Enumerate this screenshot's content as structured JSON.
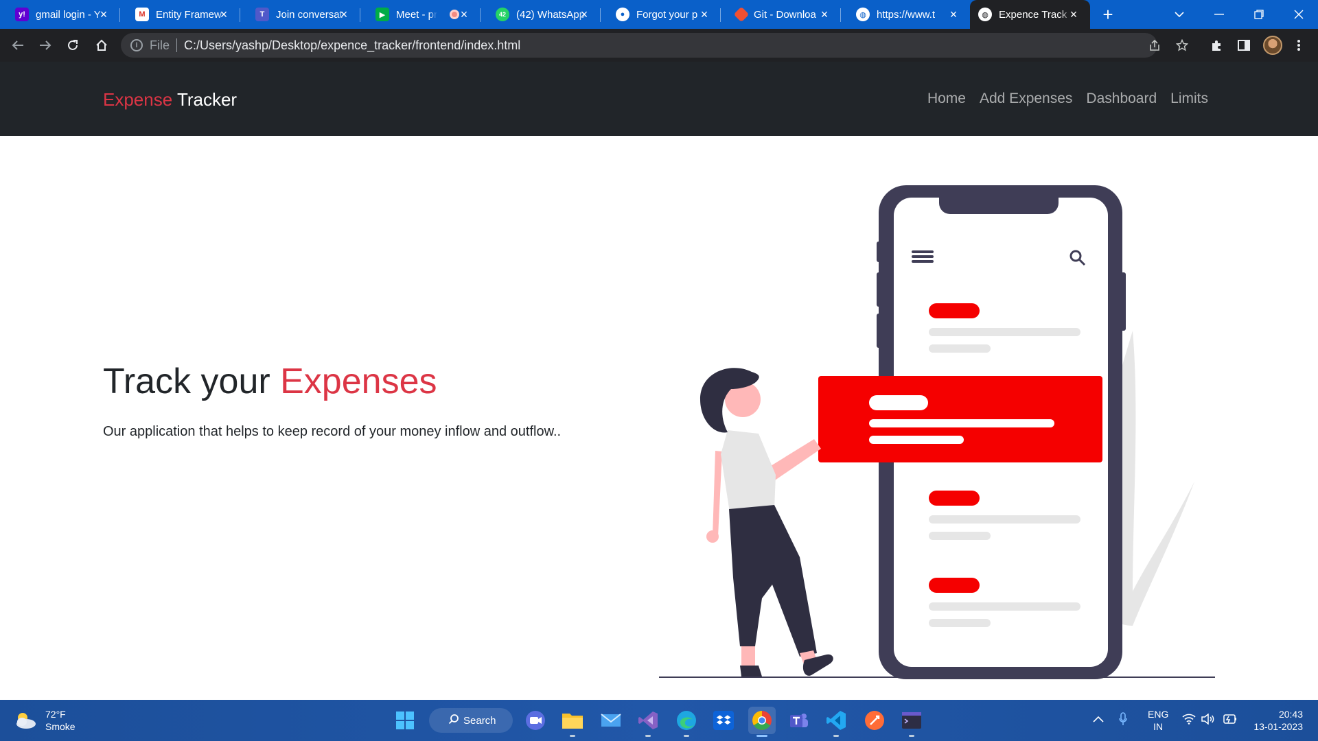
{
  "browser": {
    "tabs": [
      {
        "title": "gmail login - Y",
        "favicon": "yahoo-icon",
        "color": "#6001d2",
        "glyph": "y!"
      },
      {
        "title": "Entity Framew",
        "favicon": "gmail-icon",
        "color": "#ffffff",
        "glyph": "M"
      },
      {
        "title": "Join conversat",
        "favicon": "teams-icon",
        "color": "#5059c9",
        "glyph": "T"
      },
      {
        "title": "Meet - pr",
        "favicon": "meet-icon",
        "color": "#00ac47",
        "glyph": "▶"
      },
      {
        "title": "(42) WhatsApp",
        "favicon": "whatsapp-icon",
        "color": "#25d366",
        "glyph": "42"
      },
      {
        "title": "Forgot your p",
        "favicon": "github-icon",
        "color": "#ffffff",
        "glyph": "●"
      },
      {
        "title": "Git - Downloa",
        "favicon": "git-icon",
        "color": "#f05033",
        "glyph": "◆"
      },
      {
        "title": "https://www.t",
        "favicon": "globe-icon",
        "color": "#ffffff",
        "glyph": "◍"
      },
      {
        "title": "Expence Track",
        "favicon": "globe-icon",
        "color": "#ffffff",
        "glyph": "◍"
      }
    ],
    "address": {
      "scheme": "File",
      "url": "C:/Users/yashp/Desktop/expence_tracker/frontend/index.html"
    }
  },
  "site": {
    "brand": {
      "accent": "Expense",
      "rest": " Tracker"
    },
    "menu": [
      "Home",
      "Add Expenses",
      "Dashboard",
      "Limits"
    ],
    "hero": {
      "title_plain": "Track your ",
      "title_accent": "Expenses",
      "subtitle": "Our application that helps to keep record of your money inflow and outflow.."
    },
    "colors": {
      "accent": "#dc3545",
      "navbar": "#212529",
      "illustration_red": "#f50000",
      "phone": "#3f3d56"
    }
  },
  "taskbar": {
    "weather": {
      "temp": "72°F",
      "condition": "Smoke"
    },
    "search_label": "Search",
    "apps": [
      "start-icon",
      "search-icon",
      "zoom-icon",
      "file-explorer-icon",
      "mail-icon",
      "visual-studio-icon",
      "edge-icon",
      "dropbox-icon",
      "chrome-icon",
      "teams-icon",
      "vscode-icon",
      "postman-icon",
      "terminal-icon"
    ],
    "language": {
      "line1": "ENG",
      "line2": "IN"
    },
    "clock": {
      "time": "20:43",
      "date": "13-01-2023"
    }
  }
}
